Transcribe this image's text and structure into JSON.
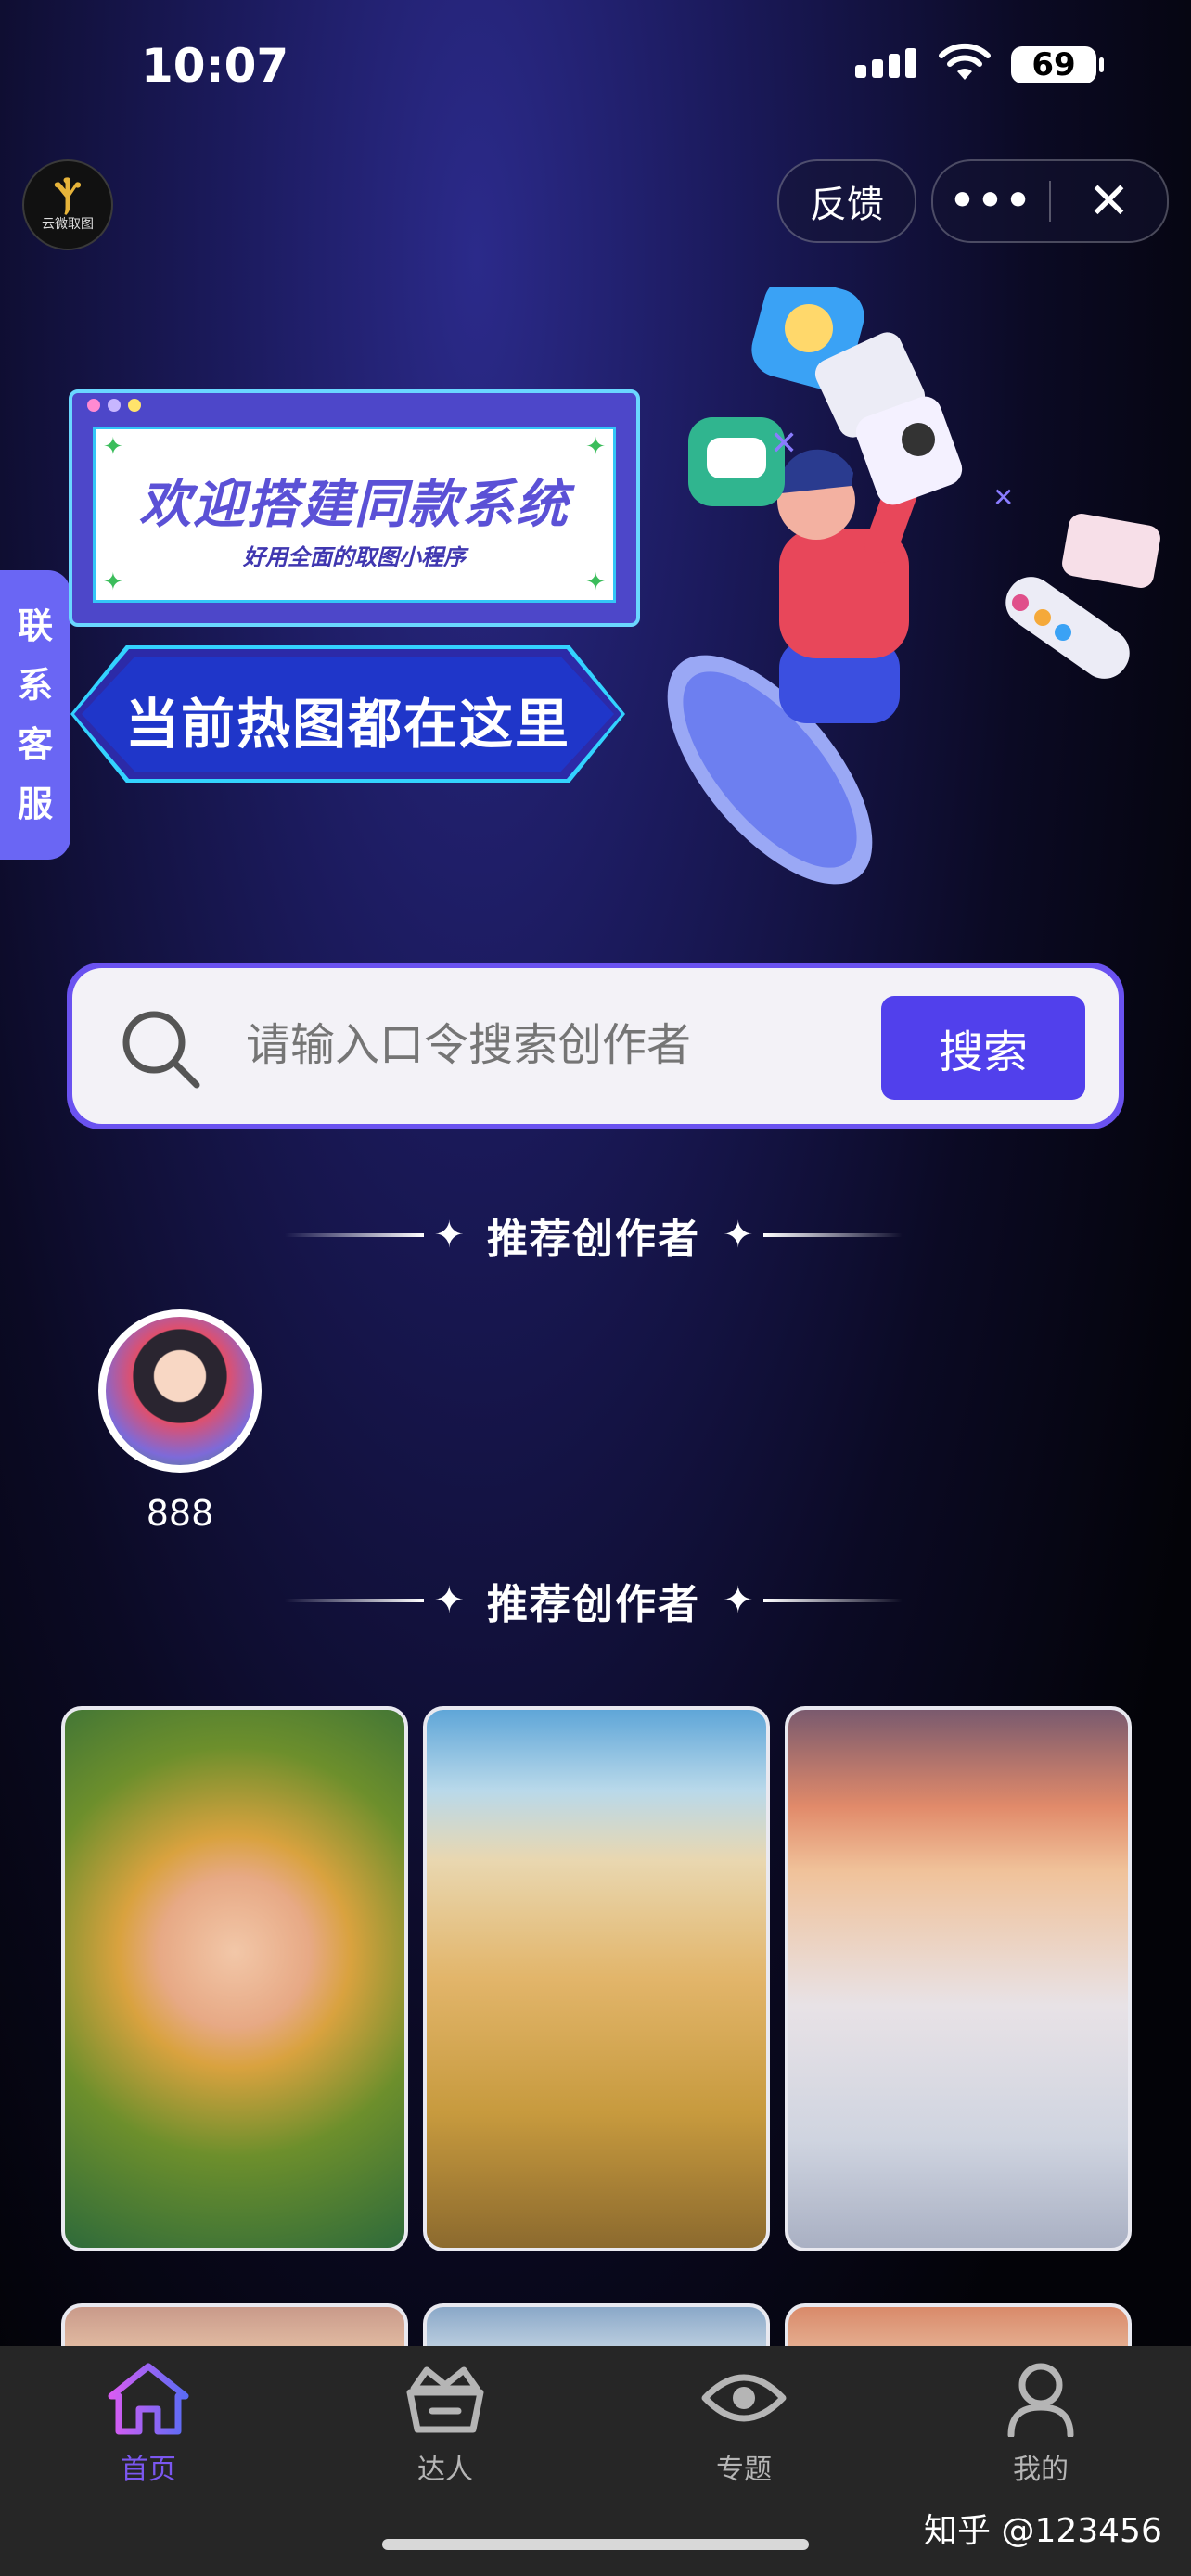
{
  "status_bar": {
    "time": "10:07",
    "battery": "69"
  },
  "header": {
    "logo_text": "云微取图",
    "feedback_label": "反馈"
  },
  "side_service": {
    "chars": [
      "联",
      "系",
      "客",
      "服"
    ]
  },
  "banner": {
    "title": "欢迎搭建同款系统",
    "subtitle": "好用全面的取图小程序",
    "slogan": "当前热图都在这里"
  },
  "search": {
    "placeholder": "请输入口令搜索创作者",
    "button_label": "搜索"
  },
  "sections": {
    "recommend_title_1": "推荐创作者",
    "recommend_title_2": "推荐创作者"
  },
  "creators": [
    {
      "name": "888"
    }
  ],
  "gallery": [
    {
      "icon": "woman-portrait-image"
    },
    {
      "icon": "girl-beach-image"
    },
    {
      "icon": "kittens-snow-image"
    }
  ],
  "tabbar": {
    "items": [
      {
        "label": "首页",
        "icon": "home-icon",
        "active": true
      },
      {
        "label": "达人",
        "icon": "crown-basket-icon",
        "active": false
      },
      {
        "label": "专题",
        "icon": "eye-icon",
        "active": false
      },
      {
        "label": "我的",
        "icon": "user-icon",
        "active": false
      }
    ],
    "active_color": "#7b57f0",
    "inactive_color": "#b5b5b5"
  },
  "watermark": "知乎 @123456",
  "colors": {
    "accent": "#5140ec",
    "side_tab": "#6a66f4"
  }
}
